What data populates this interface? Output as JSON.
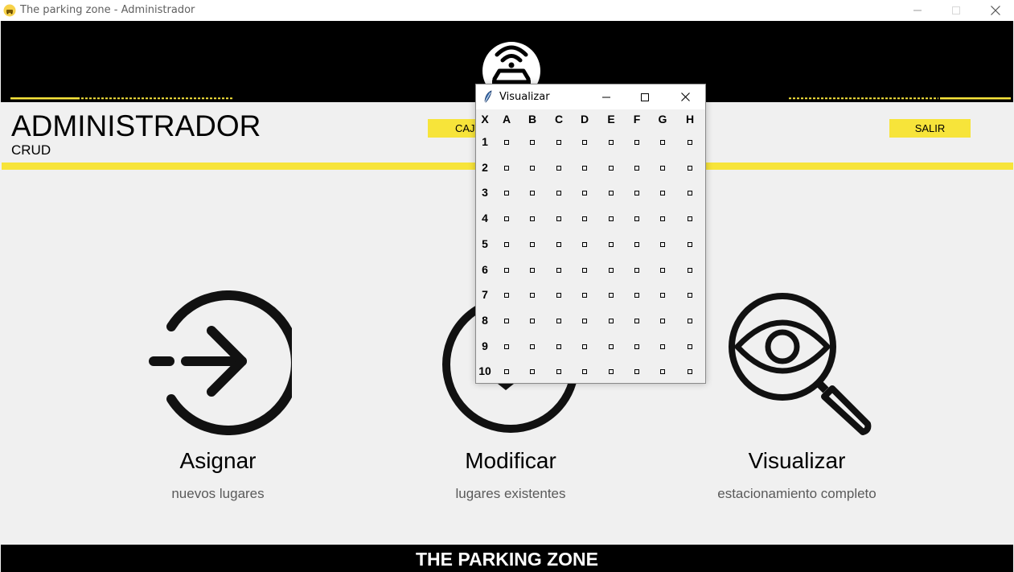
{
  "window": {
    "title": "The parking zone - Administrador"
  },
  "header": {
    "logo_icon": "parking-wifi-car-logo-icon",
    "accent_color": "#f7e43a"
  },
  "main": {
    "heading": "ADMINISTRADOR",
    "subheading": "CRUD",
    "cajones_button": "CAJONES",
    "salir_button": "SALIR",
    "cards": [
      {
        "title": "Asignar",
        "subtitle": "nuevos lugares",
        "icon": "arrow-in-circle-icon"
      },
      {
        "title": "Modificar",
        "subtitle": "lugares existentes",
        "icon": "edit-circle-icon"
      },
      {
        "title": "Visualizar",
        "subtitle": "estacionamiento completo",
        "icon": "eye-magnifier-icon"
      }
    ]
  },
  "footer": {
    "text": "THE PARKING ZONE"
  },
  "popup": {
    "title": "Visualizar",
    "corner_label": "X",
    "columns": [
      "A",
      "B",
      "C",
      "D",
      "E",
      "F",
      "G",
      "H"
    ],
    "rows": [
      "1",
      "2",
      "3",
      "4",
      "5",
      "6",
      "7",
      "8",
      "9",
      "10"
    ]
  }
}
